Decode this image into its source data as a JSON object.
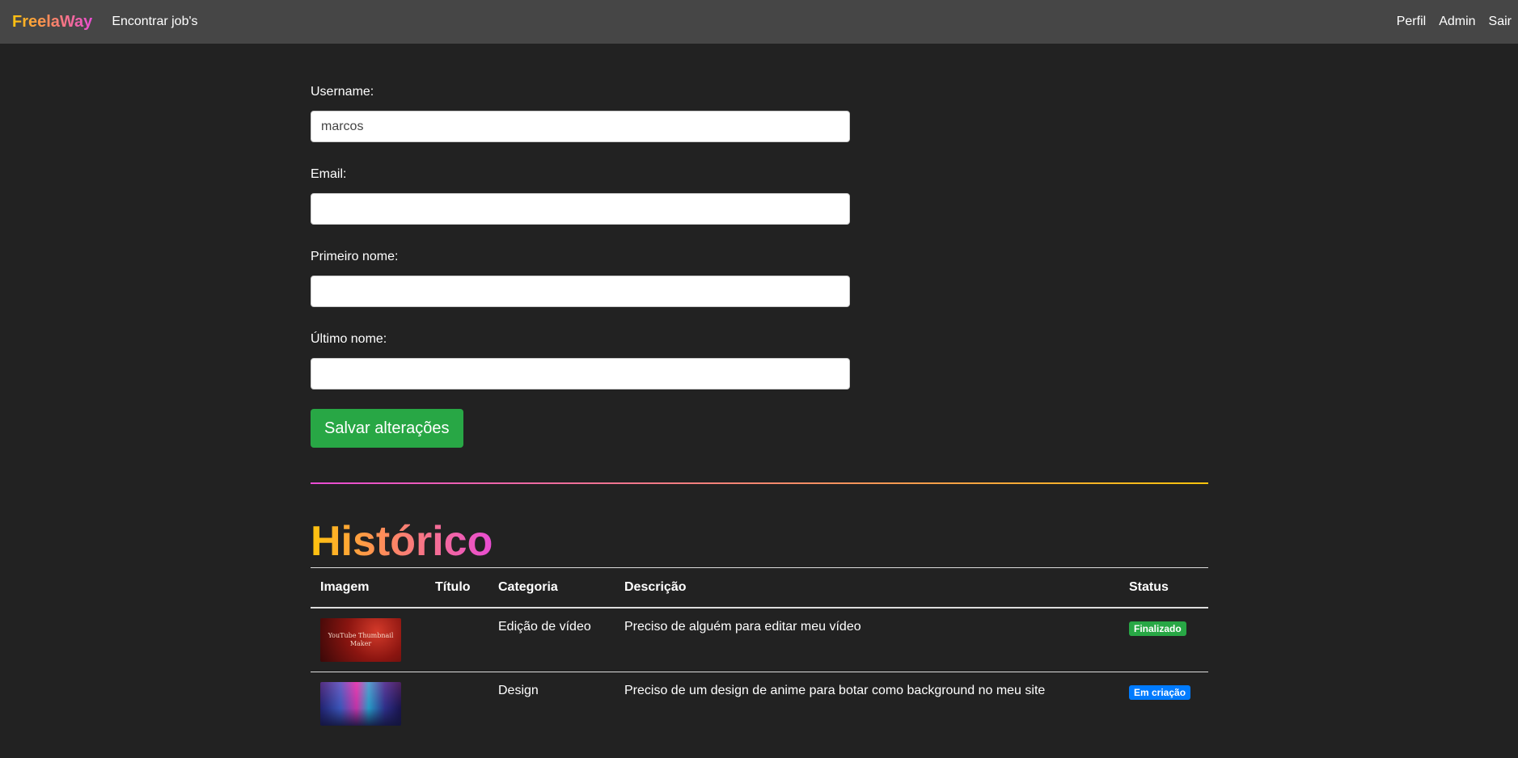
{
  "navbar": {
    "brand": "FreelaWay",
    "find_jobs": "Encontrar job's",
    "profile": "Perfil",
    "admin": "Admin",
    "logout": "Sair"
  },
  "form": {
    "username_label": "Username:",
    "username_value": "marcos",
    "email_label": "Email:",
    "email_value": "",
    "first_name_label": "Primeiro nome:",
    "first_name_value": "",
    "last_name_label": "Último nome:",
    "last_name_value": "",
    "save_label": "Salvar alterações"
  },
  "history": {
    "title": "Histórico",
    "headers": {
      "image": "Imagem",
      "title": "Título",
      "category": "Categoria",
      "description": "Descrição",
      "status": "Status"
    },
    "rows": [
      {
        "image_text": "YouTube Thumbnail Maker",
        "title": "",
        "category": "Edição de vídeo",
        "description": "Preciso de alguém para editar meu vídeo",
        "status": "Finalizado",
        "status_color": "#28a745"
      },
      {
        "image_text": "",
        "title": "",
        "category": "Design",
        "description": "Preciso de um design de anime para botar como background no meu site",
        "status": "Em criação",
        "status_color": "#007bff"
      }
    ]
  },
  "colors": {
    "background": "#222222",
    "navbar": "#464646",
    "success": "#28a745",
    "primary": "#007bff",
    "gradient_start": "#ffc40c",
    "gradient_end": "#e94cd4"
  }
}
